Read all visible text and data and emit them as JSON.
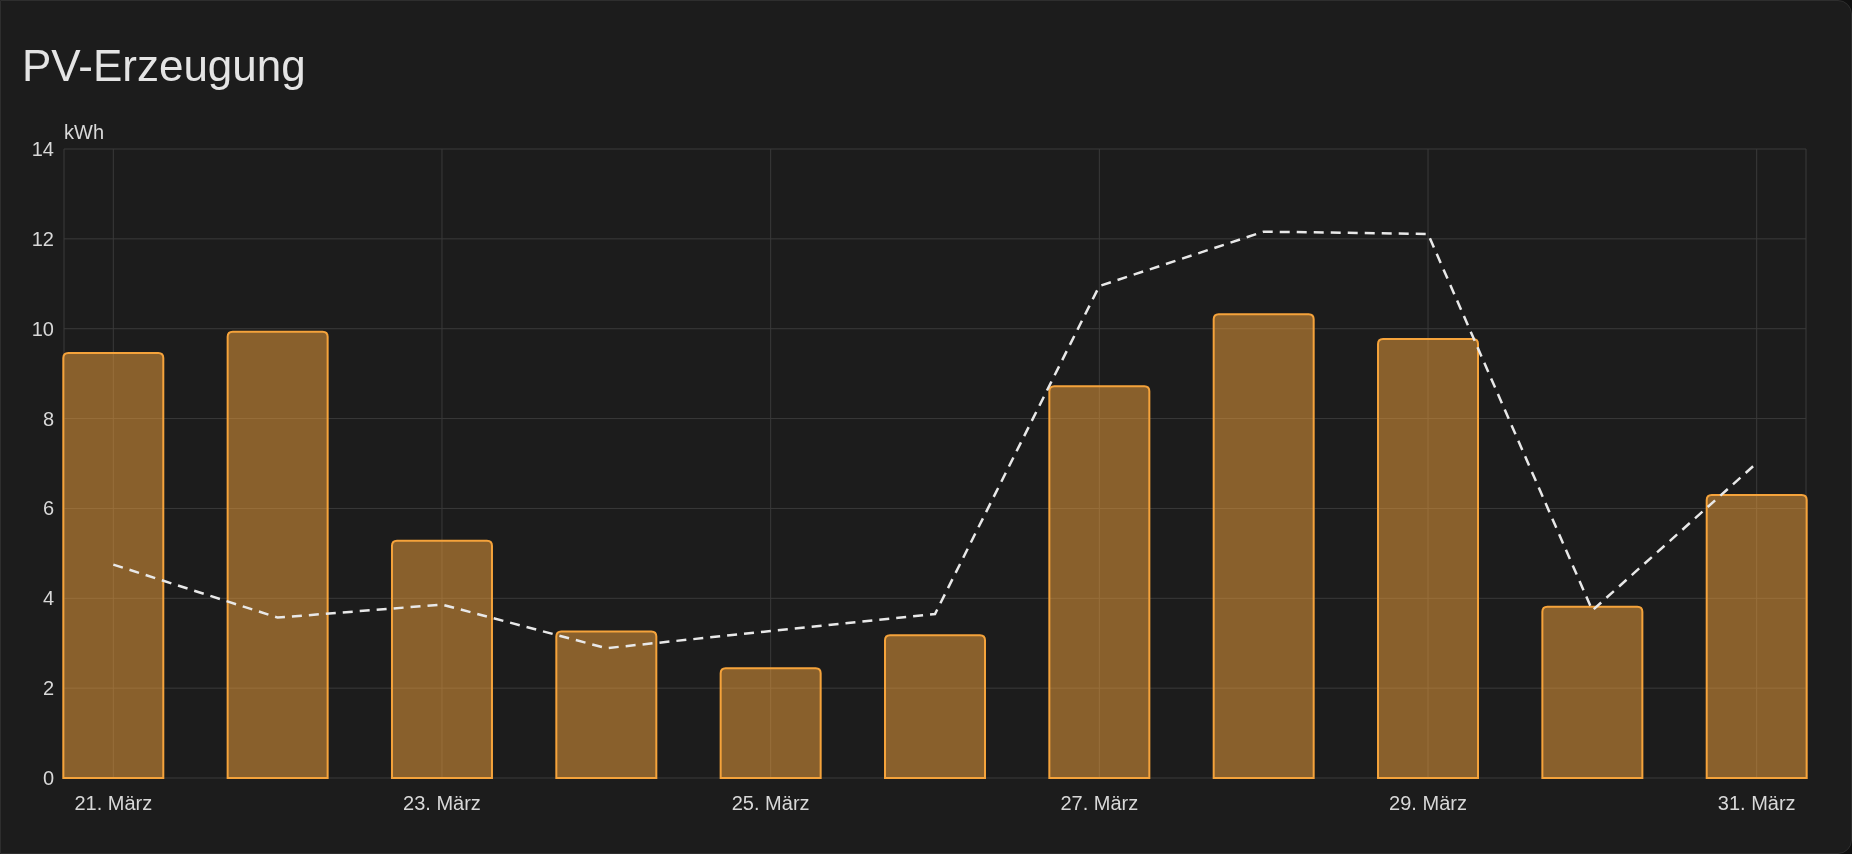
{
  "card": {
    "title": "PV-Erzeugung"
  },
  "chart_data": {
    "type": "bar",
    "grid": true,
    "ylabel": "kWh",
    "x": [
      21,
      22,
      23,
      24,
      25,
      26,
      27,
      28,
      29,
      30,
      31
    ],
    "xlim": [
      20.7,
      31.3
    ],
    "ylim": [
      0,
      14
    ],
    "yticks": [
      0,
      2,
      4,
      6,
      8,
      10,
      12,
      14
    ],
    "xticks": [
      {
        "value": 21,
        "label": "21. März"
      },
      {
        "value": 23,
        "label": "23. März"
      },
      {
        "value": 25,
        "label": "25. März"
      },
      {
        "value": 27,
        "label": "27. März"
      },
      {
        "value": 29,
        "label": "29. März"
      },
      {
        "value": 31,
        "label": "31. März"
      }
    ],
    "series": [
      {
        "type": "bar",
        "color": "#f5a33b",
        "values": [
          9.46,
          9.93,
          5.28,
          3.26,
          2.44,
          3.18,
          8.72,
          10.32,
          9.77,
          3.81,
          6.3
        ]
      },
      {
        "type": "line",
        "line_style": "dashed",
        "color": "#e8e8e8",
        "values": [
          4.75,
          3.57,
          3.86,
          2.89,
          3.27,
          3.65,
          10.95,
          12.16,
          12.11,
          3.73,
          7.01
        ]
      }
    ]
  }
}
